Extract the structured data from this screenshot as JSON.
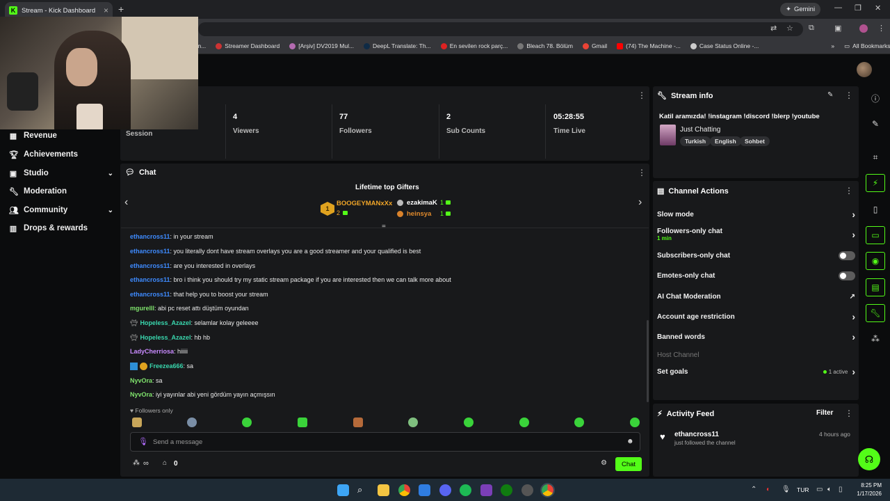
{
  "browser": {
    "tab_title": "Stream - Kick Dashboard",
    "gemini_label": "Gemini",
    "bookmarks": [
      "d / Stream...",
      "Streamer Dashboard",
      "[Arşiv] DV2019 Mul...",
      "DeepL Translate: Th...",
      "En sevilen rock parç...",
      "Bleach 78. Bölüm",
      "Gmail",
      "(74) The Machine -...",
      "Case Status Online -..."
    ],
    "all_bookmarks": "All Bookmarks"
  },
  "sidebar": {
    "items": [
      {
        "label": "Revenue",
        "icon": "dollar-icon",
        "chevron": false
      },
      {
        "label": "Achievements",
        "icon": "trophy-icon",
        "chevron": false
      },
      {
        "label": "Studio",
        "icon": "studio-icon",
        "chevron": true
      },
      {
        "label": "Moderation",
        "icon": "wrench-icon",
        "chevron": false
      },
      {
        "label": "Community",
        "icon": "community-icon",
        "chevron": true
      },
      {
        "label": "Drops & rewards",
        "icon": "gift-icon",
        "chevron": false
      }
    ]
  },
  "stats": {
    "session_label": "Session",
    "items": [
      {
        "value": "4",
        "label": "Viewers"
      },
      {
        "value": "77",
        "label": "Followers"
      },
      {
        "value": "2",
        "label": "Sub Counts"
      },
      {
        "value": "05:28:55",
        "label": "Time Live"
      }
    ]
  },
  "chat": {
    "title": "Chat",
    "gifters_title": "Lifetime top Gifters",
    "gifters": [
      {
        "rank": "1",
        "name": "BOOGEYMANxXx",
        "count": "2"
      },
      {
        "name": "ezakimaK",
        "count": "1"
      },
      {
        "name": "heinsya",
        "count": "1"
      }
    ],
    "messages": [
      {
        "user": "ethancross11",
        "text": ": in your stream",
        "color": "blue"
      },
      {
        "user": "ethancross11",
        "text": ": you literally dont have stream overlays you are a good streamer and your qualified is best",
        "color": "blue"
      },
      {
        "user": "ethancross11",
        "text": ": are you interested in overlays",
        "color": "blue"
      },
      {
        "user": "ethancross11",
        "text": ": bro i think you should try my static stream package if you are interested then we can talk more about",
        "color": "blue"
      },
      {
        "user": "ethancross11",
        "text": ": that help you to boost your stream",
        "color": "blue"
      },
      {
        "user": "mgurelll",
        "text": ": abi pc reset attı düştüm oyundan",
        "color": "green"
      },
      {
        "user": "Hopeless_Azazel",
        "text": ": selamlar kolay geleeee",
        "color": "teal"
      },
      {
        "user": "Hopeless_Azazel",
        "text": ": hb hb",
        "color": "teal"
      },
      {
        "user": "LadyCherriosa",
        "text": ": hiiiii",
        "color": "pink"
      },
      {
        "user": "Freezea666",
        "text": ": sa",
        "color": "teal"
      },
      {
        "user": "NyvOra",
        "text": ": sa",
        "color": "green"
      },
      {
        "user": "NyvOra",
        "text": ": iyi yayınlar abi yeni gördüm yayın açmışsın",
        "color": "green"
      }
    ],
    "followers_only": "Followers only",
    "input_placeholder": "Send a message",
    "infinity_label": "∞",
    "gift_count": "0",
    "send_label": "Chat"
  },
  "stream_info": {
    "title": "Stream info",
    "stream_title": "Katil aramızda! !instagram !discord !blerp !youtube",
    "category": "Just Chatting",
    "tags": [
      "Turkish",
      "English",
      "Sohbet"
    ]
  },
  "channel_actions": {
    "title": "Channel Actions",
    "items": [
      {
        "label": "Slow mode",
        "control": "arrow"
      },
      {
        "label": "Followers-only chat",
        "sub": "1 min",
        "control": "arrow"
      },
      {
        "label": "Subscribers-only chat",
        "control": "toggle"
      },
      {
        "label": "Emotes-only chat",
        "control": "toggle"
      },
      {
        "label": "AI Chat Moderation",
        "control": "external"
      },
      {
        "label": "Account age restriction",
        "control": "arrow"
      },
      {
        "label": "Banned words",
        "control": "arrow"
      },
      {
        "label": "Host Channel",
        "control": "none"
      },
      {
        "label": "Set goals",
        "status": "1 active",
        "control": "arrow"
      }
    ]
  },
  "activity": {
    "title": "Activity Feed",
    "filter_label": "Filter",
    "events": [
      {
        "user": "ethancross11",
        "text": "just followed the channel",
        "time": "4 hours ago"
      }
    ]
  },
  "taskbar": {
    "lang": "TUR",
    "time": "8:25 PM",
    "date": "1/17/2026"
  },
  "colors": {
    "accent": "#53fc18",
    "panel": "#18191b",
    "background": "#0b0c0d"
  }
}
